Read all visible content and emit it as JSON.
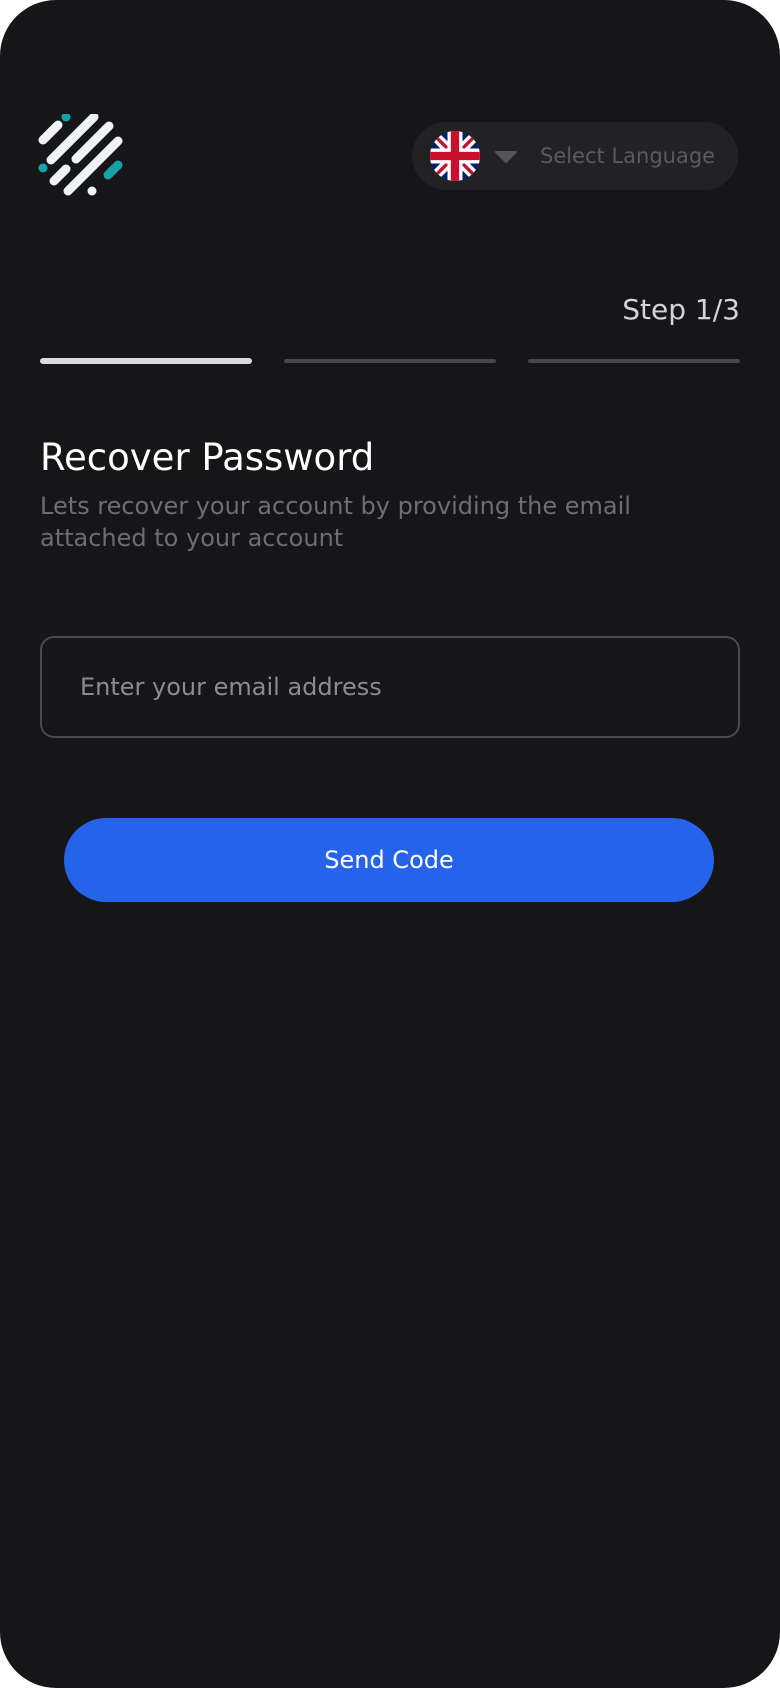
{
  "header": {
    "logo_icon": "striped-logo-icon",
    "language": {
      "flag_icon": "uk-flag-icon",
      "chevron_icon": "caret-down-icon",
      "label": "Select Language"
    }
  },
  "steps": {
    "label": "Step 1/3",
    "current": 1,
    "total": 3
  },
  "form": {
    "title": "Recover Password",
    "subtitle": "Lets recover your account by providing the email attached to your account",
    "email_placeholder": "Enter your email address",
    "email_value": "",
    "submit_label": "Send Code"
  },
  "colors": {
    "background": "#161618",
    "accent": "#2563eb",
    "logo_white": "#eef3f6",
    "logo_teal": "#16a2ad"
  }
}
